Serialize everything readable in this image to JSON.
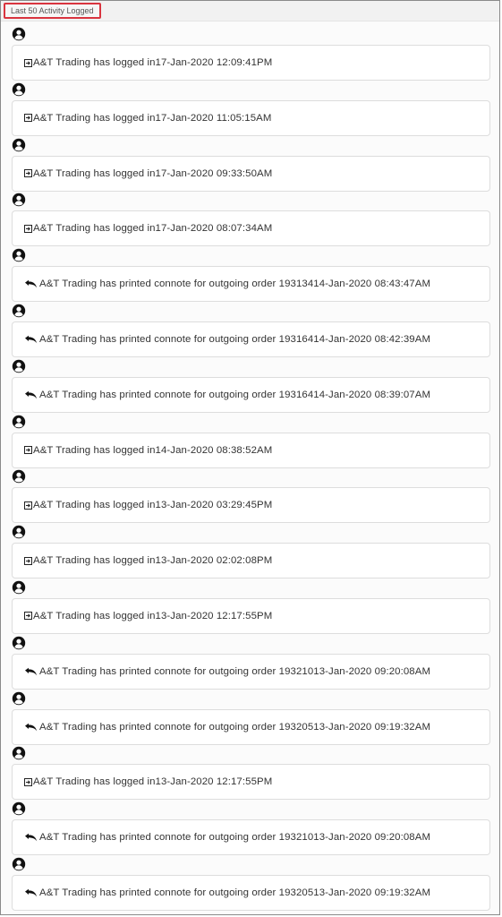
{
  "header": {
    "title": "Last 50 Activity Logged"
  },
  "icons": {
    "user": "user-circle-icon",
    "login": "login-icon",
    "print": "undo-arrow-icon"
  },
  "activities": [
    {
      "type": "login",
      "text": "A&T Trading has logged in17-Jan-2020 12:09:41PM"
    },
    {
      "type": "login",
      "text": "A&T Trading has logged in17-Jan-2020 11:05:15AM"
    },
    {
      "type": "login",
      "text": "A&T Trading has logged in17-Jan-2020 09:33:50AM"
    },
    {
      "type": "login",
      "text": "A&T Trading has logged in17-Jan-2020 08:07:34AM"
    },
    {
      "type": "print",
      "text": "A&T Trading has printed connote for outgoing order 19313414-Jan-2020 08:43:47AM"
    },
    {
      "type": "print",
      "text": "A&T Trading has printed connote for outgoing order 19316414-Jan-2020 08:42:39AM"
    },
    {
      "type": "print",
      "text": "A&T Trading has printed connote for outgoing order 19316414-Jan-2020 08:39:07AM"
    },
    {
      "type": "login",
      "text": "A&T Trading has logged in14-Jan-2020 08:38:52AM"
    },
    {
      "type": "login",
      "text": "A&T Trading has logged in13-Jan-2020 03:29:45PM"
    },
    {
      "type": "login",
      "text": "A&T Trading has logged in13-Jan-2020 02:02:08PM"
    },
    {
      "type": "login",
      "text": "A&T Trading has logged in13-Jan-2020 12:17:55PM"
    },
    {
      "type": "print",
      "text": "A&T Trading has printed connote for outgoing order 19321013-Jan-2020 09:20:08AM"
    },
    {
      "type": "print",
      "text": "A&T Trading has printed connote for outgoing order 19320513-Jan-2020 09:19:32AM"
    },
    {
      "type": "login",
      "text": "A&T Trading has logged in13-Jan-2020 12:17:55PM"
    },
    {
      "type": "print",
      "text": "A&T Trading has printed connote for outgoing order 19321013-Jan-2020 09:20:08AM"
    },
    {
      "type": "print",
      "text": "A&T Trading has printed connote for outgoing order 19320513-Jan-2020 09:19:32AM"
    }
  ]
}
